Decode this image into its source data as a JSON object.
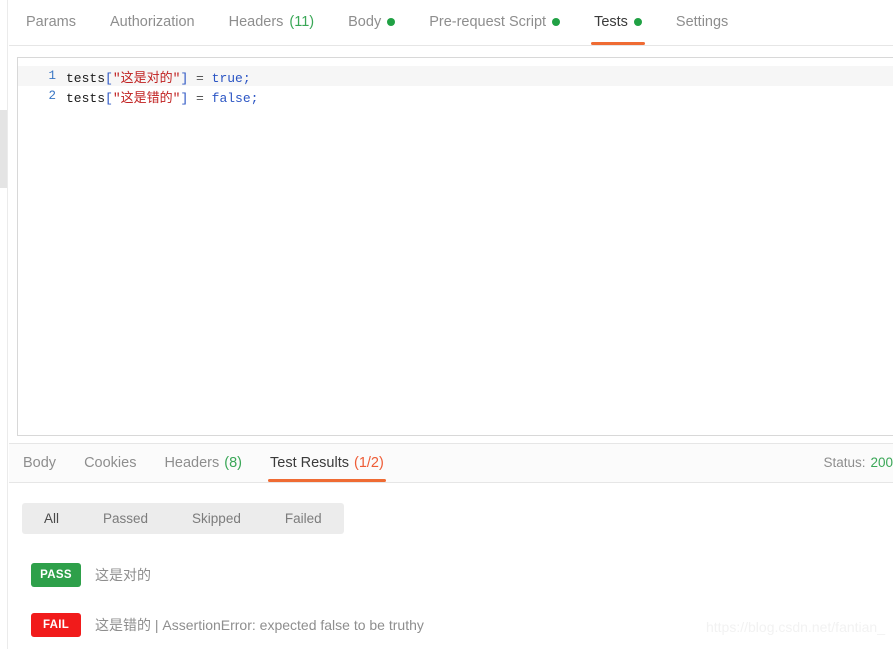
{
  "request_tabs": [
    {
      "label": "Params",
      "count": null,
      "dot": false,
      "active": false
    },
    {
      "label": "Authorization",
      "count": null,
      "dot": false,
      "active": false
    },
    {
      "label": "Headers",
      "count": "(11)",
      "dot": false,
      "active": false
    },
    {
      "label": "Body",
      "count": null,
      "dot": true,
      "active": false
    },
    {
      "label": "Pre-request Script",
      "count": null,
      "dot": true,
      "active": false
    },
    {
      "label": "Tests",
      "count": null,
      "dot": true,
      "active": true
    },
    {
      "label": "Settings",
      "count": null,
      "dot": false,
      "active": false
    }
  ],
  "editor": {
    "lines": [
      {
        "number": "1",
        "tokens": [
          {
            "text": "tests",
            "type": "ident"
          },
          {
            "text": "[",
            "type": "punct"
          },
          {
            "text": "\"这是对的\"",
            "type": "string"
          },
          {
            "text": "]",
            "type": "punct"
          },
          {
            "text": " = ",
            "type": "op"
          },
          {
            "text": "true",
            "type": "kw"
          },
          {
            "text": ";",
            "type": "semi"
          }
        ]
      },
      {
        "number": "2",
        "tokens": [
          {
            "text": "tests",
            "type": "ident"
          },
          {
            "text": "[",
            "type": "punct"
          },
          {
            "text": "\"这是错的\"",
            "type": "string"
          },
          {
            "text": "]",
            "type": "punct"
          },
          {
            "text": " = ",
            "type": "op"
          },
          {
            "text": "false",
            "type": "kw"
          },
          {
            "text": ";",
            "type": "semi"
          }
        ]
      }
    ]
  },
  "response_tabs": [
    {
      "label": "Body",
      "count": null,
      "count_color": null,
      "active": false
    },
    {
      "label": "Cookies",
      "count": null,
      "count_color": null,
      "active": false
    },
    {
      "label": "Headers",
      "count": "(8)",
      "count_color": "green",
      "active": false
    },
    {
      "label": "Test Results",
      "count": "(1/2)",
      "count_color": "red",
      "active": true
    }
  ],
  "status": {
    "label": "Status:",
    "value": "200"
  },
  "filters": [
    {
      "label": "All",
      "active": true
    },
    {
      "label": "Passed",
      "active": false
    },
    {
      "label": "Skipped",
      "active": false
    },
    {
      "label": "Failed",
      "active": false
    }
  ],
  "results": [
    {
      "badge": "PASS",
      "state": "pass",
      "text": "这是对的"
    },
    {
      "badge": "FAIL",
      "state": "fail",
      "text": "这是错的 | AssertionError: expected false to be truthy"
    }
  ],
  "watermark": "https://blog.csdn.net/fantian_",
  "colors": {
    "accent_orange": "#ef6b33",
    "pass_green": "#2ea04a",
    "fail_red": "#f11b1b",
    "count_green": "#3aa757",
    "count_red": "#ee5c36"
  }
}
